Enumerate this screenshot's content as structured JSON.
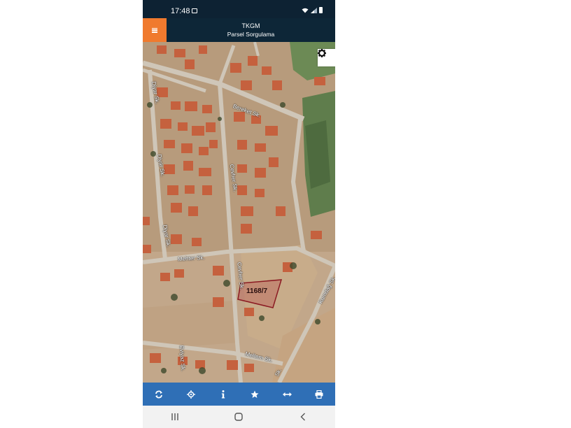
{
  "status_bar": {
    "time": "17:48"
  },
  "header": {
    "title": "TKGM",
    "subtitle": "Parsel Sorgulama"
  },
  "map": {
    "streets": [
      "Bereket Sk.",
      "Diyar Sk.",
      "Diyar Sk.",
      "Diyar Sk.",
      "Cevher Sk.",
      "Mehter Sk.",
      "Cevher Sk.",
      "Kumdağ Sk.",
      "Meltem Sk.",
      "Sk.",
      "Eviyaz Sk."
    ],
    "parcel_label": "1168/7",
    "parcel_color": "#8b1a22"
  },
  "toolbar": {
    "buttons": [
      "refresh-icon",
      "locate-icon",
      "info-icon",
      "star-icon",
      "measure-icon",
      "print-icon"
    ],
    "color": "#2f6fb6"
  },
  "nav_bar": {
    "buttons": [
      "recent-apps-icon",
      "home-icon",
      "back-icon"
    ]
  }
}
